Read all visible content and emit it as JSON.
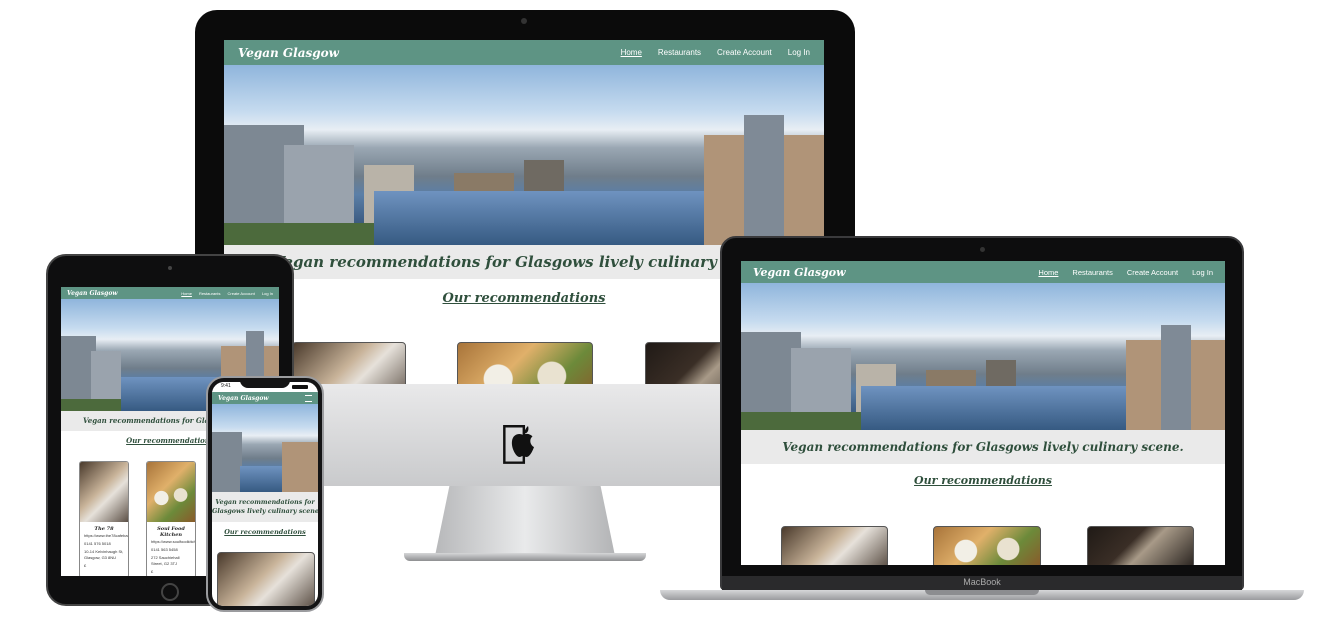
{
  "site": {
    "logo": "Vegan Glasgow",
    "nav_links": [
      "Home",
      "Restaurants",
      "Create Account",
      "Log In"
    ],
    "tagline": "Vegan recommendations for Glasgows lively culinary scene.",
    "tagline_line1": "Vegan recommendations for",
    "tagline_line2": "Glasgows lively culinary scene.",
    "tagline_tablet": "Vegan recommendations for Glasgows live",
    "recommendations_heading": "Our recommendations",
    "cards": [
      {
        "title": "The 78",
        "lines": [
          "https://www.the78cafebar.co.uk/",
          "0141 576 5018",
          "10-14 Kelvinhaugh St, Glasgow, G3 8NU",
          "£"
        ]
      },
      {
        "title": "Soul Food Kitchen",
        "lines": [
          "https://www.soulfoodkitchen.co.uk/",
          "0141 563 5458",
          "272 Sauchiehall Street, G2 3TJ",
          "£"
        ]
      }
    ]
  },
  "macbook_label": "MacBook",
  "phone_time": "9:41",
  "colors": {
    "nav": "#5e9484",
    "heading": "#2f4f3c",
    "tagline_bg": "#eaeaea"
  },
  "icons": {
    "apple_logo": "apple-logo-icon",
    "phone_status": "phone-status-icons"
  }
}
